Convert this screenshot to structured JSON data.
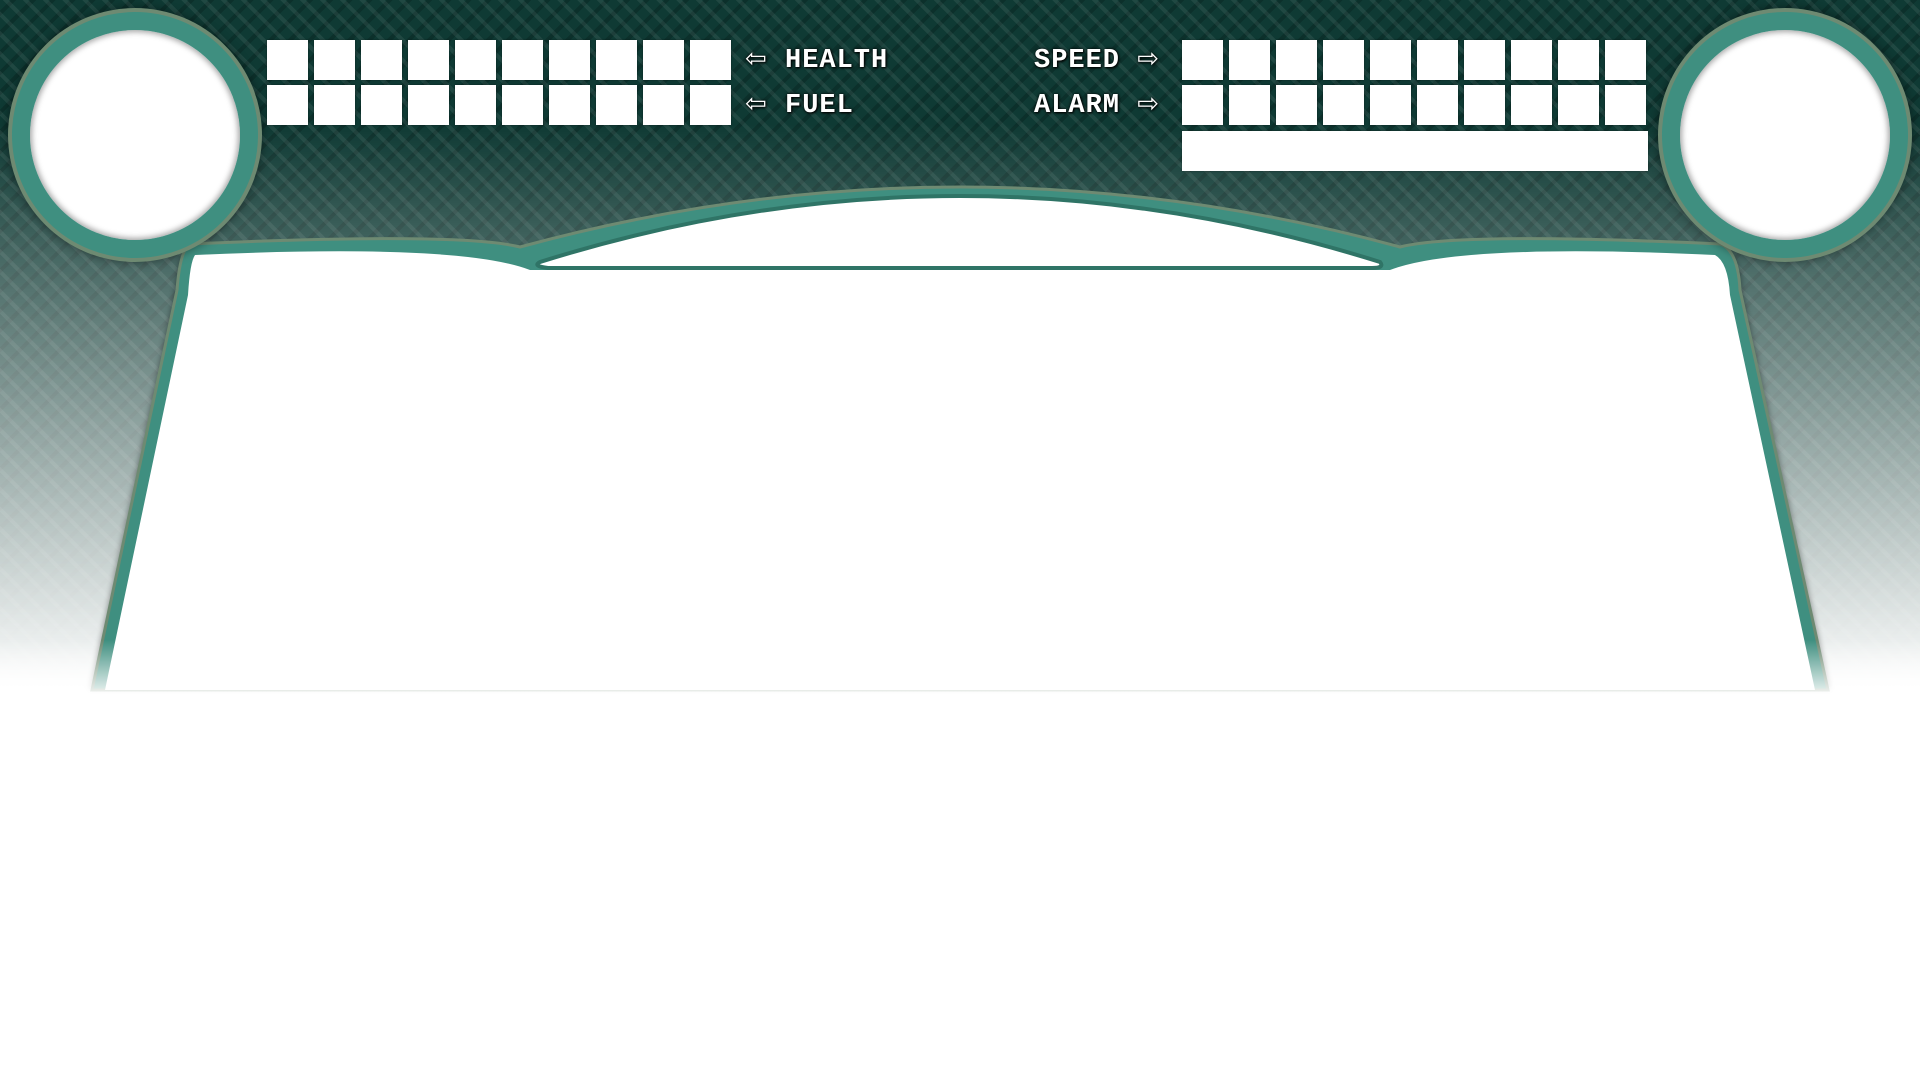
{
  "hud": {
    "health": {
      "label": "HEALTH",
      "arrow": "⇦",
      "segments": 10
    },
    "fuel": {
      "label": "FUEL",
      "arrow": "⇦",
      "segments": 10
    },
    "speed": {
      "label": "SPEED",
      "arrow": "⇨",
      "segments": 10
    },
    "alarm": {
      "label": "ALARM",
      "arrow": "⇨",
      "segments": 10
    }
  },
  "colors": {
    "panel": "#0f3a34",
    "rim": "#3f8f80",
    "rim_outline": "#6e8a72",
    "viewport": "#ffffff"
  },
  "icons": {
    "left_arrow": "left-arrow-icon",
    "right_arrow": "right-arrow-icon"
  }
}
